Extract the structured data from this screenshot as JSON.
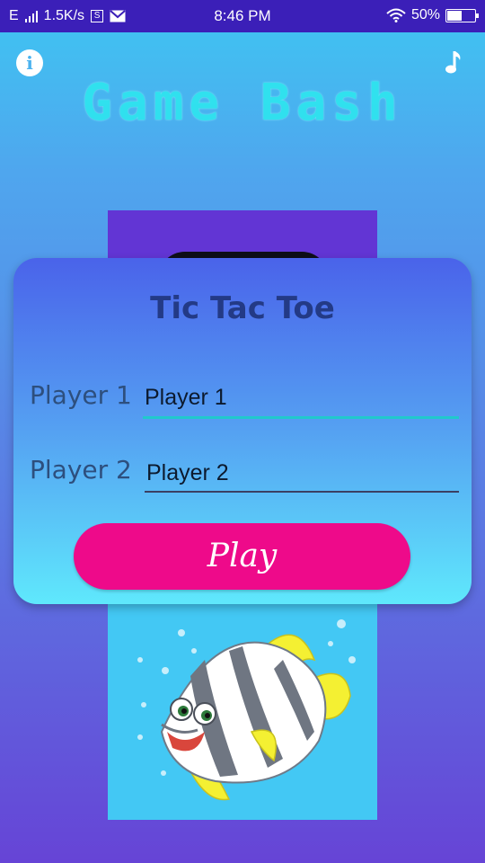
{
  "status_bar": {
    "network_speed": "1.5K/s",
    "time": "8:46 PM",
    "battery": "50%",
    "battery_level": 0.5,
    "network_type": "E",
    "s_badge": "S"
  },
  "header": {
    "title": "Game Bash",
    "info_icon": "info-icon",
    "music_icon": "music-note-icon"
  },
  "dialog": {
    "title": "Tic Tac Toe",
    "player1_label": "Player 1",
    "player1_value": "Player 1",
    "player2_label": "Player 2",
    "player2_value": "Player 2",
    "play_label": "Play"
  },
  "colors": {
    "status_bar": "#3b1fb8",
    "title_accent": "#2ee6ee",
    "play_button": "#ee0a8a",
    "dialog_title": "#233a86"
  }
}
